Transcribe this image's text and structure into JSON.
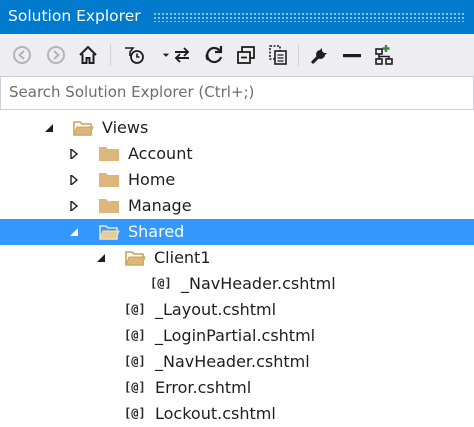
{
  "window": {
    "title": "Solution Explorer"
  },
  "toolbar": {
    "buttons": [
      {
        "icon": "back-icon"
      },
      {
        "icon": "forward-icon"
      },
      {
        "icon": "home-icon"
      },
      {
        "icon": "pending-changes-filter-icon"
      },
      {
        "icon": "sync-with-active-document-icon"
      },
      {
        "icon": "refresh-icon"
      },
      {
        "icon": "collapse-all-icon"
      },
      {
        "icon": "show-all-files-icon"
      },
      {
        "icon": "properties-icon"
      },
      {
        "icon": "minus-icon"
      },
      {
        "icon": "class-view-icon"
      }
    ]
  },
  "search": {
    "placeholder": "Search Solution Explorer (Ctrl+;)",
    "value": ""
  },
  "tree": {
    "razor_badge": "[@]",
    "items": [
      {
        "label": "Views",
        "type": "folder",
        "state": "expanded"
      },
      {
        "label": "Account",
        "type": "folder",
        "state": "collapsed"
      },
      {
        "label": "Home",
        "type": "folder",
        "state": "collapsed"
      },
      {
        "label": "Manage",
        "type": "folder",
        "state": "collapsed"
      },
      {
        "label": "Shared",
        "type": "folder",
        "state": "expanded",
        "selected": true
      },
      {
        "label": "Client1",
        "type": "folder",
        "state": "expanded"
      },
      {
        "label": "_NavHeader.cshtml",
        "type": "razor-file"
      },
      {
        "label": "_Layout.cshtml",
        "type": "razor-file"
      },
      {
        "label": "_LoginPartial.cshtml",
        "type": "razor-file"
      },
      {
        "label": "_NavHeader.cshtml",
        "type": "razor-file"
      },
      {
        "label": "Error.cshtml",
        "type": "razor-file"
      },
      {
        "label": "Lockout.cshtml",
        "type": "razor-file"
      }
    ]
  },
  "colors": {
    "title_bar": "#007acc",
    "toolbar": "#eeeef2",
    "selection": "#3399ff",
    "folder": "#dcb67a"
  }
}
